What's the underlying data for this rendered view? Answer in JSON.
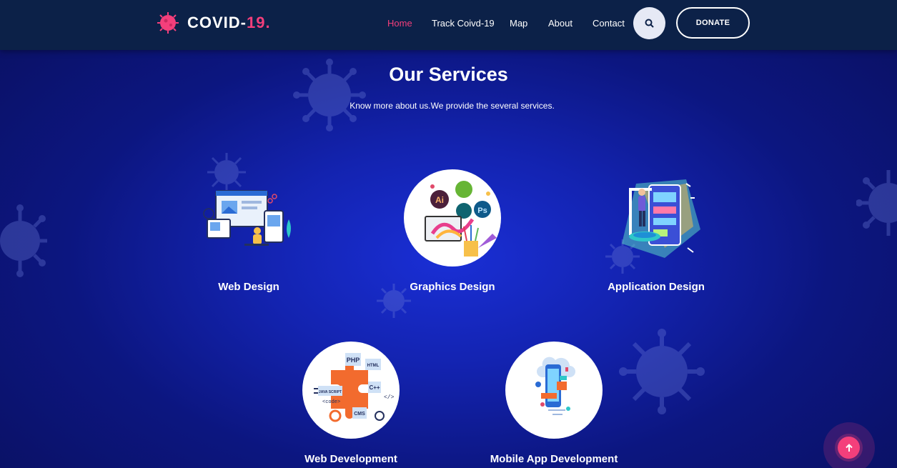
{
  "brand": {
    "name_main": "COVID-",
    "name_accent": "19.",
    "icon": "virus-logo-icon",
    "accent_color": "#f43f7b"
  },
  "nav": {
    "items": [
      {
        "label": "Home",
        "active": true
      },
      {
        "label": "Track Coivd-19",
        "active": false
      },
      {
        "label": "Map",
        "active": false
      },
      {
        "label": "About",
        "active": false
      },
      {
        "label": "Contact",
        "active": false
      }
    ],
    "search_icon": "search-icon",
    "donate_label": "DONATE"
  },
  "section": {
    "title": "Our Services",
    "subtitle": "Know more about us.We provide the several services."
  },
  "services": [
    {
      "label": "Web Design",
      "icon": "web-design-illustration"
    },
    {
      "label": "Graphics Design",
      "icon": "graphics-design-illustration"
    },
    {
      "label": "Application Design",
      "icon": "application-design-illustration"
    },
    {
      "label": "Web Development",
      "icon": "web-development-illustration"
    },
    {
      "label": "Mobile App Development",
      "icon": "mobile-app-illustration"
    }
  ],
  "scroll_top_icon": "arrow-up-icon"
}
